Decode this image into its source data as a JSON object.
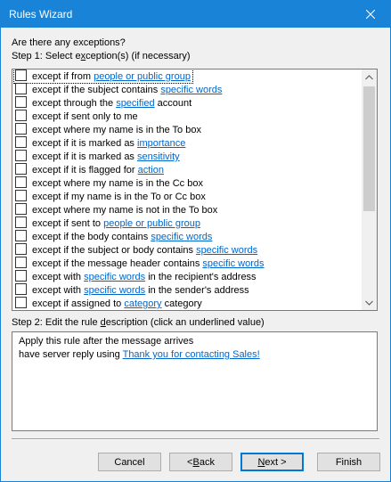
{
  "window": {
    "title": "Rules Wizard",
    "close_glyph": "✕"
  },
  "heading": "Are there any exceptions?",
  "step1": {
    "before": "Step 1: Select e",
    "accel": "x",
    "after": "ception(s) (if necessary)"
  },
  "exceptions": [
    {
      "parts": [
        {
          "t": "except if from "
        },
        {
          "t": "people or public group",
          "link": true
        }
      ]
    },
    {
      "parts": [
        {
          "t": "except if the subject contains "
        },
        {
          "t": "specific words",
          "link": true
        }
      ]
    },
    {
      "parts": [
        {
          "t": "except through the "
        },
        {
          "t": "specified",
          "link": true
        },
        {
          "t": " account"
        }
      ]
    },
    {
      "parts": [
        {
          "t": "except if sent only to me"
        }
      ]
    },
    {
      "parts": [
        {
          "t": "except where my name is in the To box"
        }
      ]
    },
    {
      "parts": [
        {
          "t": "except if it is marked as "
        },
        {
          "t": "importance",
          "link": true
        }
      ]
    },
    {
      "parts": [
        {
          "t": "except if it is marked as "
        },
        {
          "t": "sensitivity",
          "link": true
        }
      ]
    },
    {
      "parts": [
        {
          "t": "except if it is flagged for "
        },
        {
          "t": "action",
          "link": true
        }
      ]
    },
    {
      "parts": [
        {
          "t": "except where my name is in the Cc box"
        }
      ]
    },
    {
      "parts": [
        {
          "t": "except if my name is in the To or Cc box"
        }
      ]
    },
    {
      "parts": [
        {
          "t": "except where my name is not in the To box"
        }
      ]
    },
    {
      "parts": [
        {
          "t": "except if sent to "
        },
        {
          "t": "people or public group",
          "link": true
        }
      ]
    },
    {
      "parts": [
        {
          "t": "except if the body contains "
        },
        {
          "t": "specific words",
          "link": true
        }
      ]
    },
    {
      "parts": [
        {
          "t": "except if the subject or body contains "
        },
        {
          "t": "specific words",
          "link": true
        }
      ]
    },
    {
      "parts": [
        {
          "t": "except if the message header contains "
        },
        {
          "t": "specific words",
          "link": true
        }
      ]
    },
    {
      "parts": [
        {
          "t": "except with "
        },
        {
          "t": "specific words",
          "link": true
        },
        {
          "t": " in the recipient's address"
        }
      ]
    },
    {
      "parts": [
        {
          "t": "except with "
        },
        {
          "t": "specific words",
          "link": true
        },
        {
          "t": " in the sender's address"
        }
      ]
    },
    {
      "parts": [
        {
          "t": "except if assigned to "
        },
        {
          "t": "category",
          "link": true
        },
        {
          "t": " category"
        }
      ]
    }
  ],
  "step2": {
    "before": "Step 2: Edit the rule ",
    "accel": "d",
    "after": "escription (click an underlined value)"
  },
  "description": {
    "line1": "Apply this rule after the message arrives",
    "line2_text": "have server reply using ",
    "line2_link": "Thank you for contacting Sales!"
  },
  "buttons": {
    "cancel": "Cancel",
    "back": {
      "pre": "< ",
      "accel": "B",
      "post": "ack"
    },
    "next": {
      "accel": "N",
      "post": "ext >"
    },
    "finish": "Finish"
  },
  "colors": {
    "titlebar": "#1883d7",
    "link": "#0066cc"
  }
}
